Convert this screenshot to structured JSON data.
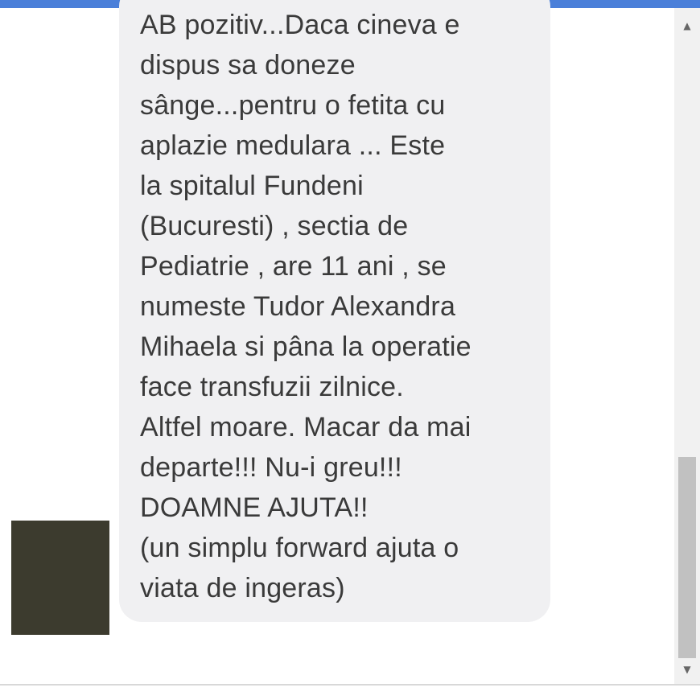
{
  "message": {
    "text": "AB pozitiv...Daca cineva e\ndispus sa doneze\nsânge...pentru o fetita cu\naplazie medulara ... Este\nla spitalul Fundeni\n(Bucuresti) , sectia de\nPediatrie , are 11 ani , se\nnumeste Tudor Alexandra\nMihaela si pâna la operatie\nface transfuzii zilnice.\nAltfel moare. Macar da mai\ndeparte!!! Nu-i greu!!!\nDOAMNE AJUTA!!\n(un simplu forward ajuta o\nviata de ingeras)"
  },
  "scrollbar": {
    "up_icon": "▲",
    "down_icon": "▼"
  },
  "colors": {
    "accent": "#4a7fd9",
    "bubble": "#f0f0f2",
    "avatar": "#3c3b2e"
  }
}
